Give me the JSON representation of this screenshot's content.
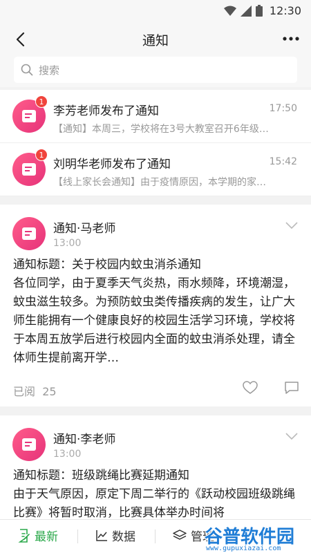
{
  "status_bar": {
    "time": "12:30"
  },
  "header": {
    "title": "通知"
  },
  "search": {
    "placeholder": "搜索"
  },
  "notices": [
    {
      "title": "李芳老师发布了通知",
      "time": "17:50",
      "preview": "【通知】本周三，学校将在3号大教室召开6年级…",
      "badge": "1"
    },
    {
      "title": "刘明华老师发布了通知",
      "time": "15:42",
      "preview": "【线上家长会通知】由于疫情原因，本学期的家…",
      "badge": "1"
    }
  ],
  "cards": [
    {
      "sender": "通知·马老师",
      "time": "13:00",
      "title_line": "通知标题：关于校园内蚊虫消杀通知",
      "body": "各位同学，由于夏季天气炎热，雨水频降，环境潮湿，蚊虫滋生较多。为预防蚊虫类传播疾病的发生，让广大师生能拥有一个健康良好的校园生活学习环境，学校将于本周五放学后进行校园内全面的蚊虫消杀处理，请全体师生提前离开学…",
      "read_label": "已阅",
      "read_count": "25"
    },
    {
      "sender": "通知·李老师",
      "time": "13:00",
      "title_line": "通知标题：班级跳绳比赛延期通知",
      "body": "由于天气原因，原定下周二举行的《跃动校园班级跳绳比赛》将暂时取消，比赛具体举办时间将"
    }
  ],
  "tabs": [
    {
      "label": "最新",
      "icon": "edit-icon",
      "active": true
    },
    {
      "label": "数据",
      "icon": "line-chart-icon",
      "active": false
    },
    {
      "label": "管理",
      "icon": "layers-icon",
      "active": false
    }
  ],
  "watermark": {
    "text": "谷普软件园",
    "url": "www.gupuxiazai.com"
  },
  "colors": {
    "accent": "#2aa84a",
    "avatar": "#e6337a",
    "badge": "#f0443c",
    "watermark": "#1f7dd6"
  }
}
